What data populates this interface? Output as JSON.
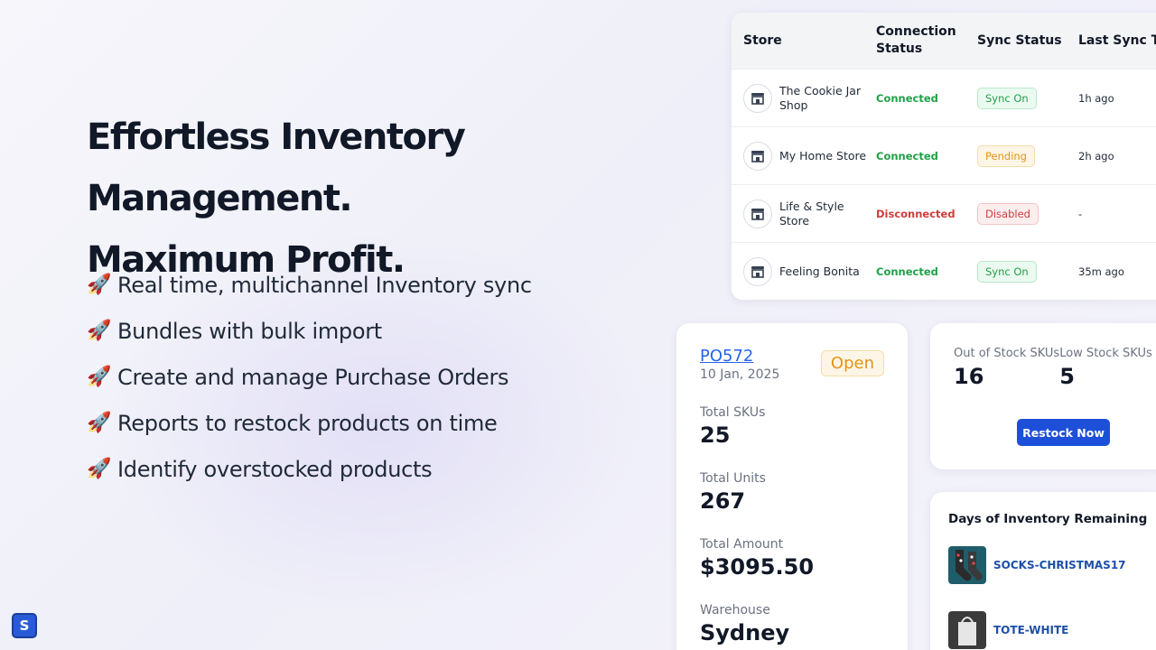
{
  "hero": {
    "headline_line1": "Effortless Inventory Management.",
    "headline_line2": "Maximum Profit.",
    "features": [
      "Real time, multichannel Inventory sync",
      "Bundles with bulk import",
      "Create and manage Purchase Orders",
      "Reports to restock products on time",
      "Identify overstocked products"
    ],
    "feature_icon": "🚀"
  },
  "stores_table": {
    "headers": {
      "store": "Store",
      "connection": "Connection Status",
      "sync": "Sync Status",
      "last_sync": "Last Sync Time"
    },
    "rows": [
      {
        "store": "The Cookie Jar Shop",
        "connection": "Connected",
        "sync": "Sync On",
        "last_sync": "1h ago"
      },
      {
        "store": "My Home Store",
        "connection": "Connected",
        "sync": "Pending",
        "last_sync": "2h ago"
      },
      {
        "store": "Life & Style Store",
        "connection": "Disconnected",
        "sync": "Disabled",
        "last_sync": "-"
      },
      {
        "store": "Feeling Bonita",
        "connection": "Connected",
        "sync": "Sync On",
        "last_sync": "35m ago"
      }
    ]
  },
  "purchase_order": {
    "id": "PO572",
    "date": "10 Jan, 2025",
    "status": "Open",
    "total_skus_label": "Total SKUs",
    "total_skus": "25",
    "total_units_label": "Total Units",
    "total_units": "267",
    "total_amount_label": "Total Amount",
    "total_amount": "$3095.50",
    "warehouse_label": "Warehouse",
    "warehouse": "Sydney"
  },
  "stock_summary": {
    "out_of_stock_label": "Out of Stock SKUs",
    "out_of_stock": "16",
    "low_stock_label": "Low Stock SKUs",
    "low_stock": "5",
    "restock_button": "Restock Now"
  },
  "days_remaining": {
    "title": "Days of Inventory Remaining",
    "items": [
      {
        "sku": "SOCKS-CHRISTMAS17"
      },
      {
        "sku": "TOTE-WHITE"
      }
    ]
  },
  "logo_letter": "S",
  "colors": {
    "accent": "#1d4fd8",
    "connected": "#22a047",
    "disconnected": "#d03b3b",
    "pending": "#e49317"
  }
}
